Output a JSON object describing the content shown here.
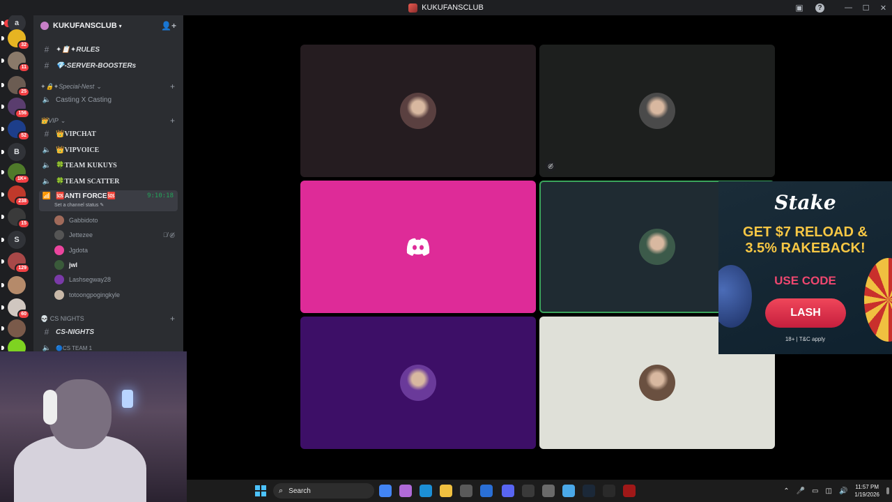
{
  "window": {
    "title": "KUKUFANSCLUB",
    "help": "?",
    "minimize": "—",
    "maximize": "☐",
    "close": "✕"
  },
  "server_rail": {
    "new_label": "NEW",
    "servers": [
      {
        "name": "a",
        "letter": "a",
        "badge": "",
        "color": "#313338"
      },
      {
        "name": "pikachu",
        "letter": "",
        "badge": "32",
        "color": "#e6b422"
      },
      {
        "name": "dinday",
        "letter": "",
        "badge": "11",
        "color": "#8a7a6a"
      },
      {
        "name": "face1",
        "letter": "",
        "badge": "25",
        "color": "#6b5c52"
      },
      {
        "name": "anime",
        "letter": "",
        "badge": "156",
        "color": "#5a3d6e"
      },
      {
        "name": "tcl",
        "letter": "",
        "badge": "52",
        "color": "#1d3e8a"
      },
      {
        "name": "b",
        "letter": "B",
        "badge": "",
        "color": "#313338"
      },
      {
        "name": "green-server",
        "letter": "",
        "badge": "1K+",
        "color": "#4f7a2a"
      },
      {
        "name": "kukufans",
        "letter": "",
        "badge": "238",
        "color": "#c0392b"
      },
      {
        "name": "speaker",
        "letter": "",
        "badge": "15",
        "color": "#3a3a3a"
      },
      {
        "name": "s",
        "letter": "S",
        "badge": "",
        "color": "#313338"
      },
      {
        "name": "red-server",
        "letter": "",
        "badge": "129",
        "color": "#a84848"
      },
      {
        "name": "face2",
        "letter": "",
        "badge": "",
        "color": "#b58a6a"
      },
      {
        "name": "face3",
        "letter": "",
        "badge": "60",
        "color": "#d0c7c0"
      },
      {
        "name": "crowd",
        "letter": "",
        "badge": "",
        "color": "#7a5a4a"
      },
      {
        "name": "lime",
        "letter": "",
        "badge": "",
        "color": "#7ed321"
      }
    ]
  },
  "sidebar": {
    "guild_name": "KUKUFANSCLUB",
    "channels_top": [
      {
        "label": "✦📋✦RULES",
        "type": "text"
      },
      {
        "label": "💎-SERVER-BOOSTERs",
        "type": "text"
      }
    ],
    "special_category": "✦🔒✦Special-Nest",
    "special_channels": [
      {
        "label": "Casting X Casting",
        "type": "voice"
      }
    ],
    "vip_category": "👑VIP",
    "vip_channels": [
      {
        "label": "👑VIPCHAT",
        "type": "text"
      },
      {
        "label": "👑VIPVOICE",
        "type": "voice"
      },
      {
        "label": "🍀TEAM KUKUYS",
        "type": "voice"
      },
      {
        "label": "🍀TEAM SCATTER",
        "type": "voice"
      }
    ],
    "active_channel": {
      "label": "🆘ANTI FORCE🆘",
      "timer": "9:10:18",
      "status": "Set a channel status ✎"
    },
    "voice_users": [
      {
        "name": "Gabbidoto",
        "color": "#a06a5a",
        "icons": ""
      },
      {
        "name": "Jettezee",
        "color": "#555555",
        "icons": "🎙̸ ◎̸"
      },
      {
        "name": "Jgdota",
        "color": "#eb459e",
        "icons": ""
      },
      {
        "name": "jwl",
        "color": "#3a5a3a",
        "icons": ""
      },
      {
        "name": "Lashsegway28",
        "color": "#7a3aa8",
        "icons": ""
      },
      {
        "name": "totoongpogingkyle",
        "color": "#c8b8a8",
        "icons": ""
      }
    ],
    "cs_category": "💀 CS NIGHTS",
    "cs_channels": [
      {
        "label": "CS-NIGHTS",
        "type": "text"
      },
      {
        "label": "🔵CS TEAM 1",
        "type": "voice"
      }
    ]
  },
  "video_tiles": [
    {
      "id": "tile-1",
      "bg": "#251c20",
      "avatar_color": "#5a4040",
      "kind": "avatar",
      "muted": false,
      "speaking": false
    },
    {
      "id": "tile-2",
      "bg": "#1d1f1e",
      "avatar_color": "#4a4a4a",
      "kind": "avatar",
      "muted": true,
      "speaking": false
    },
    {
      "id": "tile-3",
      "bg": "#de2b98",
      "avatar_color": "",
      "kind": "discord",
      "muted": false,
      "speaking": false
    },
    {
      "id": "tile-4",
      "bg": "#1f2b32",
      "avatar_color": "#3c5a4a",
      "kind": "avatar",
      "muted": false,
      "speaking": true
    },
    {
      "id": "tile-5",
      "bg": "#3d0f67",
      "avatar_color": "#6a3a9a",
      "kind": "avatar",
      "muted": false,
      "speaking": false
    },
    {
      "id": "tile-6",
      "bg": "#dfe0d8",
      "avatar_color": "#6a5040",
      "kind": "avatar",
      "muted": false,
      "speaking": false
    }
  ],
  "ad": {
    "brand": "Stake",
    "headline_line1": "GET $7 RELOAD &",
    "headline_line2": "3.5% RAKEBACK!",
    "use_code": "USE CODE",
    "code": "LASH",
    "terms": "18+ | T&C apply"
  },
  "taskbar": {
    "search_placeholder": "Search",
    "apps": [
      {
        "name": "chrome",
        "color": "#4285f4"
      },
      {
        "name": "copilot",
        "color": "#b06ad8"
      },
      {
        "name": "edge",
        "color": "#1c8fd6"
      },
      {
        "name": "file-explorer",
        "color": "#f0c040"
      },
      {
        "name": "store",
        "color": "#5a5a5a"
      },
      {
        "name": "mail",
        "color": "#2a6fd6"
      },
      {
        "name": "discord",
        "color": "#5865f2"
      },
      {
        "name": "obs",
        "color": "#3a3a3a"
      },
      {
        "name": "calculator",
        "color": "#6a6a6a"
      },
      {
        "name": "notepad",
        "color": "#4aa8e8"
      },
      {
        "name": "steam",
        "color": "#1b2838"
      },
      {
        "name": "logitech",
        "color": "#2a2a2a"
      },
      {
        "name": "dota",
        "color": "#a01818"
      }
    ],
    "time": "11:57 PM",
    "date": "1/19/2026"
  }
}
